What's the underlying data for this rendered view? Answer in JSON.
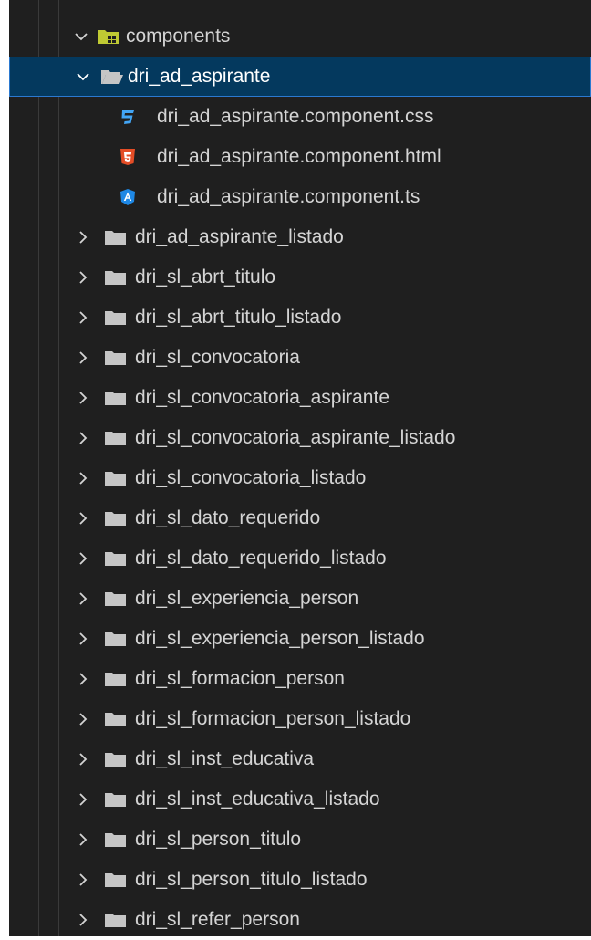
{
  "tree": {
    "root": {
      "label": "components",
      "expanded": true
    },
    "selected_folder": {
      "label": "dri_ad_aspirante",
      "expanded": true
    },
    "files": [
      {
        "label": "dri_ad_aspirante.component.css",
        "icon": "css-file-icon",
        "color": "#42a5f5"
      },
      {
        "label": "dri_ad_aspirante.component.html",
        "icon": "html-file-icon",
        "color": "#e44d26"
      },
      {
        "label": "dri_ad_aspirante.component.ts",
        "icon": "angular-file-icon",
        "color": "#1e88e5"
      }
    ],
    "folders": [
      "dri_ad_aspirante_listado",
      "dri_sl_abrt_titulo",
      "dri_sl_abrt_titulo_listado",
      "dri_sl_convocatoria",
      "dri_sl_convocatoria_aspirante",
      "dri_sl_convocatoria_aspirante_listado",
      "dri_sl_convocatoria_listado",
      "dri_sl_dato_requerido",
      "dri_sl_dato_requerido_listado",
      "dri_sl_experiencia_person",
      "dri_sl_experiencia_person_listado",
      "dri_sl_formacion_person",
      "dri_sl_formacion_person_listado",
      "dri_sl_inst_educativa",
      "dri_sl_inst_educativa_listado",
      "dri_sl_person_titulo",
      "dri_sl_person_titulo_listado",
      "dri_sl_refer_person"
    ]
  },
  "colors": {
    "background": "#1f1f1f",
    "selection": "#04395e",
    "selection_border": "#2b79d0",
    "text": "#d4d4d4",
    "folder": "#c5c5c5",
    "components_folder": "#c0ca33"
  }
}
